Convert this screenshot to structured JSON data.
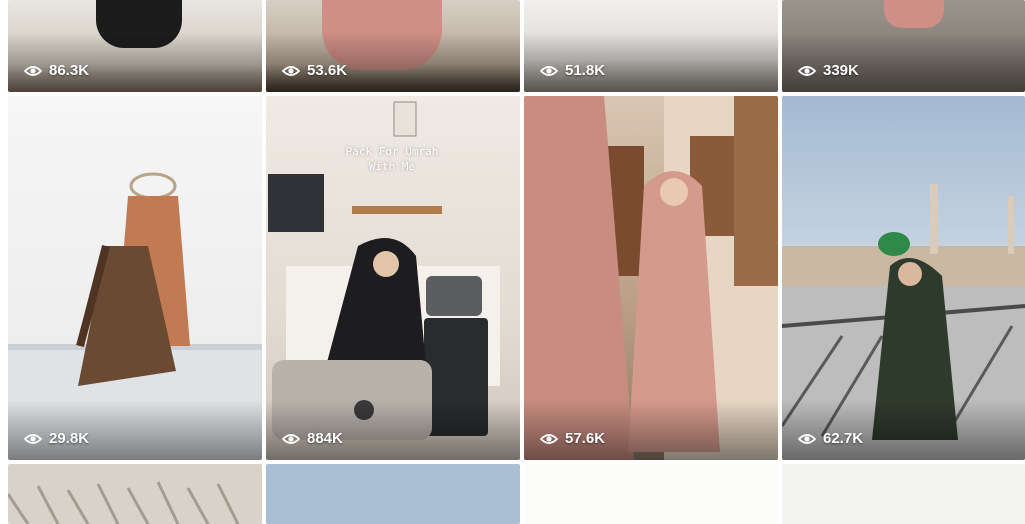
{
  "tiles": [
    {
      "views": "86.3K",
      "overlay": ""
    },
    {
      "views": "53.6K",
      "overlay": ""
    },
    {
      "views": "51.8K",
      "overlay": ""
    },
    {
      "views": "339K",
      "overlay": ""
    },
    {
      "views": "29.8K",
      "overlay": ""
    },
    {
      "views": "884K",
      "overlay": "Pack For Umrah With Me"
    },
    {
      "views": "57.6K",
      "overlay": ""
    },
    {
      "views": "62.7K",
      "overlay": ""
    },
    {
      "views": "",
      "overlay": ""
    },
    {
      "views": "",
      "overlay": ""
    },
    {
      "views": "",
      "overlay": ""
    },
    {
      "views": "",
      "overlay": ""
    }
  ],
  "icons": {
    "views": "eye-icon"
  },
  "colors": {
    "overlay_text": "#ffffff",
    "blush_pink": "#d99b8e",
    "sage_green": "#3b4a3a",
    "sky_blue": "#a9bfd6"
  }
}
